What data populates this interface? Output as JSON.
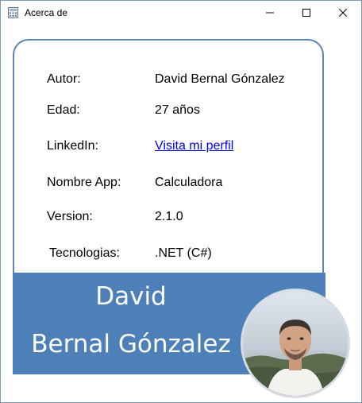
{
  "window": {
    "title": "Acerca de",
    "icon": "calculator-icon",
    "controls": [
      "minimize-icon",
      "maximize-icon",
      "close-icon"
    ]
  },
  "info": {
    "autor_label": "Autor:",
    "autor_value": "David Bernal Gónzalez",
    "edad_label": "Edad:",
    "edad_value": "27 años",
    "linkedin_label": "LinkedIn:",
    "linkedin_value": "Visita mi perfil",
    "app_label": "Nombre App:",
    "app_value": "Calculadora",
    "version_label": "Version:",
    "version_value": "2.1.0",
    "tech_label": "Tecnologias:",
    "tech_value": ".NET (C#)"
  },
  "banner": {
    "first_name": "David",
    "last_names": "Bernal Gónzalez"
  },
  "colors": {
    "banner": "#4d80b8",
    "card_border": "#5b87b9",
    "link": "#0000ee"
  }
}
